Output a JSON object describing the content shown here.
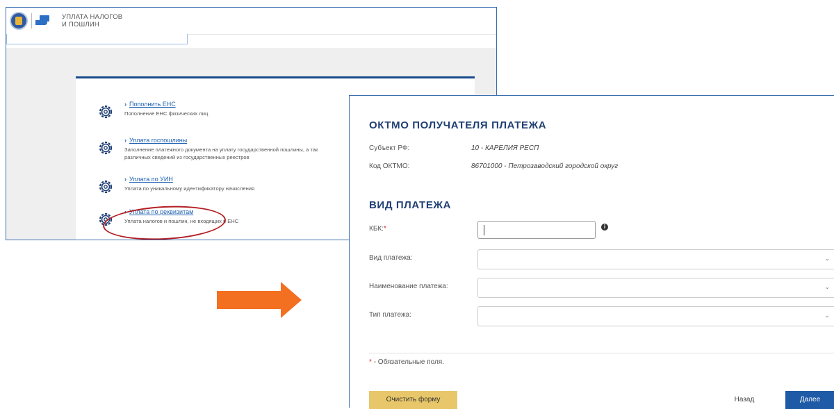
{
  "left_screen": {
    "brand_line1": "УПЛАТА НАЛОГОВ",
    "brand_line2": "И ПОШЛИН",
    "items": [
      {
        "title": "Пополнить ЕНС",
        "desc": "Пополнение ЕНС физических лиц"
      },
      {
        "title": "Уплата госпошлины",
        "desc": "Заполнение платежного документа на уплату государственной пошлины, а так",
        "desc2": "различных сведений из государственных реестров"
      },
      {
        "title": "Уплата по УИН",
        "desc": "Уплата по уникальному идентификатору начисления"
      },
      {
        "title": "Уплата по реквизитам",
        "desc": "Уплата налогов и пошлин, не входящих в ЕНС"
      }
    ]
  },
  "right_screen": {
    "oktmo_heading": "ОКТМО ПОЛУЧАТЕЛЯ ПЛАТЕЖА",
    "subject_label": "Субъект РФ:",
    "subject_value": "10 - КАРЕЛИЯ РЕСП",
    "oktmo_label": "Код ОКТМО:",
    "oktmo_value": "86701000 - Петрозаводский городской округ",
    "payment_heading": "ВИД ПЛАТЕЖА",
    "kbk_label": "КБК:",
    "required_mark": "*",
    "kbk_value": "",
    "payment_type_label": "Вид платежа:",
    "payment_name_label": "Наименование платежа:",
    "payment_kind_label": "Тип платежа:",
    "required_note": "- Обязательные поля.",
    "clear_button": "Очистить форму",
    "back_button": "Назад",
    "next_button": "Далее"
  },
  "colors": {
    "arrow": "#f37021",
    "highlight_oval": "#b21e23",
    "heading": "#1f3f73",
    "primary_button": "#1f5aa6",
    "clear_button": "#e8c76a"
  }
}
